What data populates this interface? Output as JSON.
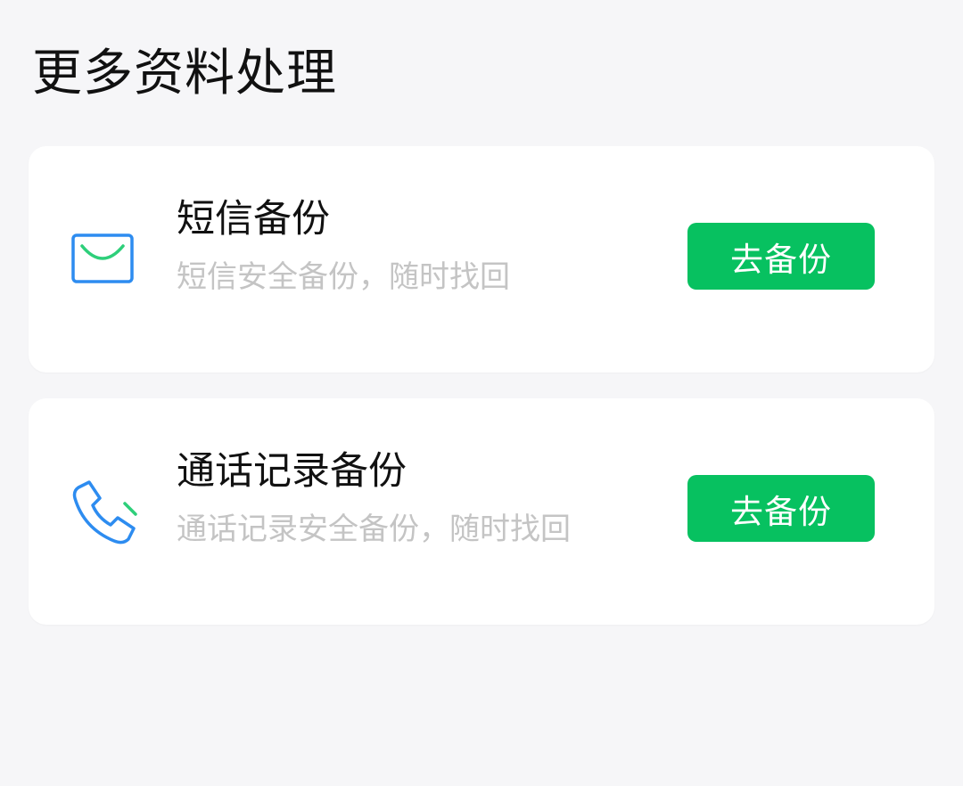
{
  "page": {
    "title": "更多资料处理"
  },
  "cards": [
    {
      "icon": "envelope-icon",
      "title": "短信备份",
      "description": "短信安全备份，随时找回",
      "button_label": "去备份"
    },
    {
      "icon": "phone-icon",
      "title": "通话记录备份",
      "description": "通话记录安全备份，随时找回",
      "button_label": "去备份"
    }
  ],
  "colors": {
    "background": "#f6f6f8",
    "card": "#ffffff",
    "accent_green": "#07c160",
    "icon_blue": "#2d8cf0",
    "icon_green": "#2ecf7a",
    "subtext": "#c4c4c4"
  }
}
